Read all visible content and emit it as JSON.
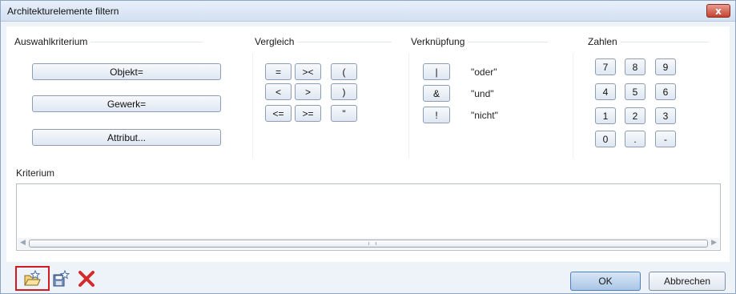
{
  "window": {
    "title": "Architekturelemente filtern",
    "close_label": "x"
  },
  "groups": {
    "auswahl": {
      "title": "Auswahlkriterium",
      "buttons": [
        "Objekt=",
        "Gewerk=",
        "Attribut..."
      ]
    },
    "vergleich": {
      "title": "Vergleich",
      "buttons": [
        "=",
        "><",
        "(",
        "<",
        ">",
        ")",
        "<=",
        ">=",
        "\""
      ]
    },
    "verknuepfung": {
      "title": "Verknüpfung",
      "items": [
        {
          "symbol": "|",
          "label": "\"oder\""
        },
        {
          "symbol": "&",
          "label": "\"und\""
        },
        {
          "symbol": "!",
          "label": "\"nicht\""
        }
      ]
    },
    "zahlen": {
      "title": "Zahlen",
      "buttons": [
        "7",
        "8",
        "9",
        "4",
        "5",
        "6",
        "1",
        "2",
        "3",
        "0",
        ".",
        "-"
      ]
    }
  },
  "kriterium": {
    "label": "Kriterium",
    "value": ""
  },
  "footer": {
    "ok_label": "OK",
    "cancel_label": "Abbrechen"
  },
  "icons": {
    "open": "folder-star-icon",
    "save": "save-star-icon",
    "delete": "red-x-icon"
  },
  "colors": {
    "highlight": "#d31b1b",
    "delete": "#d32b2b"
  }
}
